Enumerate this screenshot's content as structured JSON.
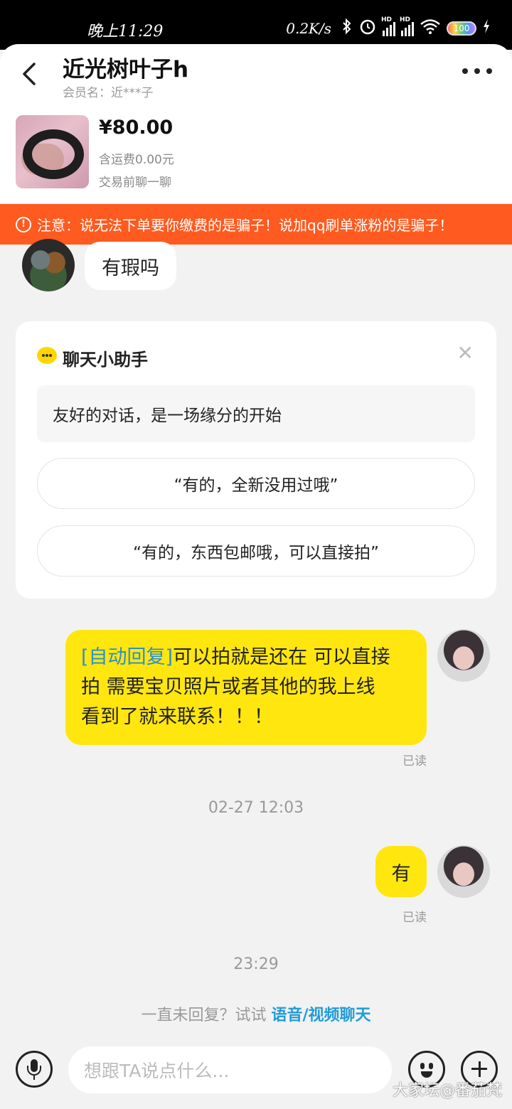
{
  "status_bar": {
    "time": "晚上11:29",
    "speed": "0.2K/s",
    "battery": "100"
  },
  "header": {
    "title": "近光树叶子h",
    "subtitle": "会员名：近***子"
  },
  "product": {
    "price": "¥80.00",
    "shipping": "含运费0.00元",
    "prechat": "交易前聊一聊"
  },
  "warning": "注意：说无法下单要你缴费的是骗子！说加qq刷单涨粉的是骗子！",
  "messages": {
    "incoming_1": "有瑕吗",
    "auto_reply_tag": "[自动回复]",
    "auto_reply_line1": "可以拍就是还在 可以直接",
    "auto_reply_line2": "拍 需要宝贝照片或者其他的我上线",
    "auto_reply_line3": "看到了就来联系！！！",
    "read_1": "已读",
    "timestamp_1": "02-27 12:03",
    "outgoing_2": "有",
    "read_2": "已读",
    "timestamp_2": "23:29"
  },
  "helper": {
    "title": "聊天小助手",
    "intro": "友好的对话，是一场缘分的开始",
    "options": [
      "“有的，全新没用过哦”",
      "“有的，东西包邮哦，可以直接拍”"
    ]
  },
  "hint": {
    "text": "一直未回复？试试 ",
    "link": "语音/视频聊天"
  },
  "input": {
    "placeholder": "想跟TA说点什么..."
  },
  "watermark": "大家坛@番茄梵"
}
